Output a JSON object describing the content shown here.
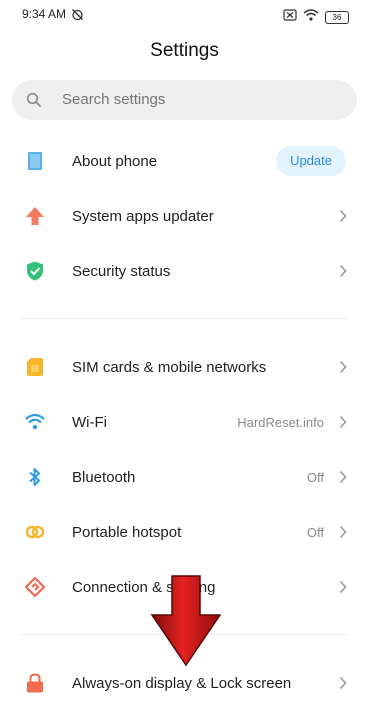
{
  "status": {
    "time": "9:34 AM",
    "battery": "36"
  },
  "title": "Settings",
  "search": {
    "placeholder": "Search settings"
  },
  "sections": [
    {
      "items": [
        {
          "label": "About phone",
          "action": "Update"
        },
        {
          "label": "System apps updater"
        },
        {
          "label": "Security status"
        }
      ]
    },
    {
      "items": [
        {
          "label": "SIM cards & mobile networks"
        },
        {
          "label": "Wi-Fi",
          "value": "HardReset.info"
        },
        {
          "label": "Bluetooth",
          "value": "Off"
        },
        {
          "label": "Portable hotspot",
          "value": "Off"
        },
        {
          "label": "Connection & sharing"
        }
      ]
    },
    {
      "items": [
        {
          "label": "Always-on display & Lock screen"
        }
      ]
    }
  ],
  "colors": {
    "accent_blue": "#2a8ad8",
    "update_bg": "#e3f3fc",
    "arrow_red": "#d71a1a"
  },
  "icons": {
    "about": "phone-icon",
    "updater": "up-arrow-icon",
    "security": "shield-check-icon",
    "sim": "sim-card-icon",
    "wifi": "wifi-icon",
    "bluetooth": "bluetooth-icon",
    "hotspot": "hotspot-icon",
    "connection": "connection-icon",
    "lock": "lock-icon",
    "overlay": "red-down-arrow-icon"
  }
}
